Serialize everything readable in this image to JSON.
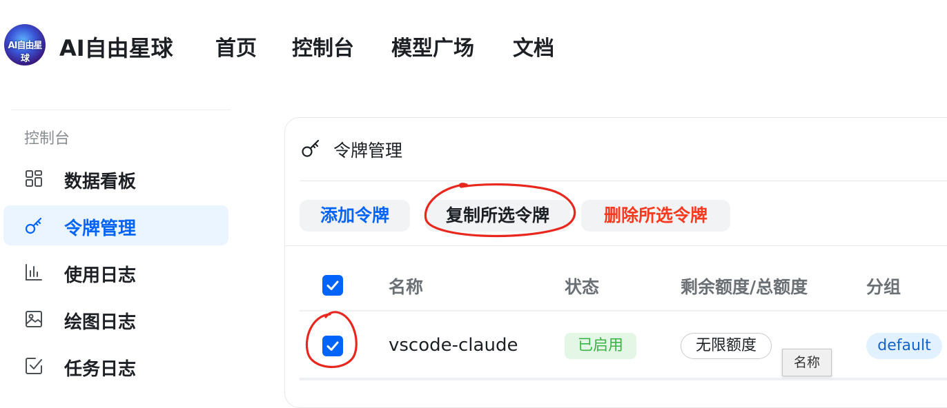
{
  "header": {
    "logo_text": "AI自由星球",
    "brand": "AI自由星球",
    "nav": [
      "首页",
      "控制台",
      "模型广场",
      "文档"
    ]
  },
  "sidebar": {
    "section": "控制台",
    "items": [
      {
        "label": "数据看板",
        "icon": "dashboard-grid-icon"
      },
      {
        "label": "令牌管理",
        "icon": "key-icon",
        "active": true
      },
      {
        "label": "使用日志",
        "icon": "bar-chart-icon"
      },
      {
        "label": "绘图日志",
        "icon": "image-icon"
      },
      {
        "label": "任务日志",
        "icon": "task-check-icon"
      }
    ]
  },
  "card": {
    "title": "令牌管理",
    "buttons": {
      "add": "添加令牌",
      "copy": "复制所选令牌",
      "delete": "删除所选令牌"
    },
    "table": {
      "headers": [
        "名称",
        "状态",
        "剩余额度/总额度",
        "分组"
      ],
      "rows": [
        {
          "name": "vscode-claude",
          "status": "已启用",
          "quota": "无限额度",
          "group": "default",
          "checked": true
        }
      ]
    },
    "tooltip": "名称"
  },
  "colors": {
    "primary": "#0064fa",
    "danger": "#f93920",
    "success": "#3bb346",
    "annotation": "#e8281e"
  }
}
